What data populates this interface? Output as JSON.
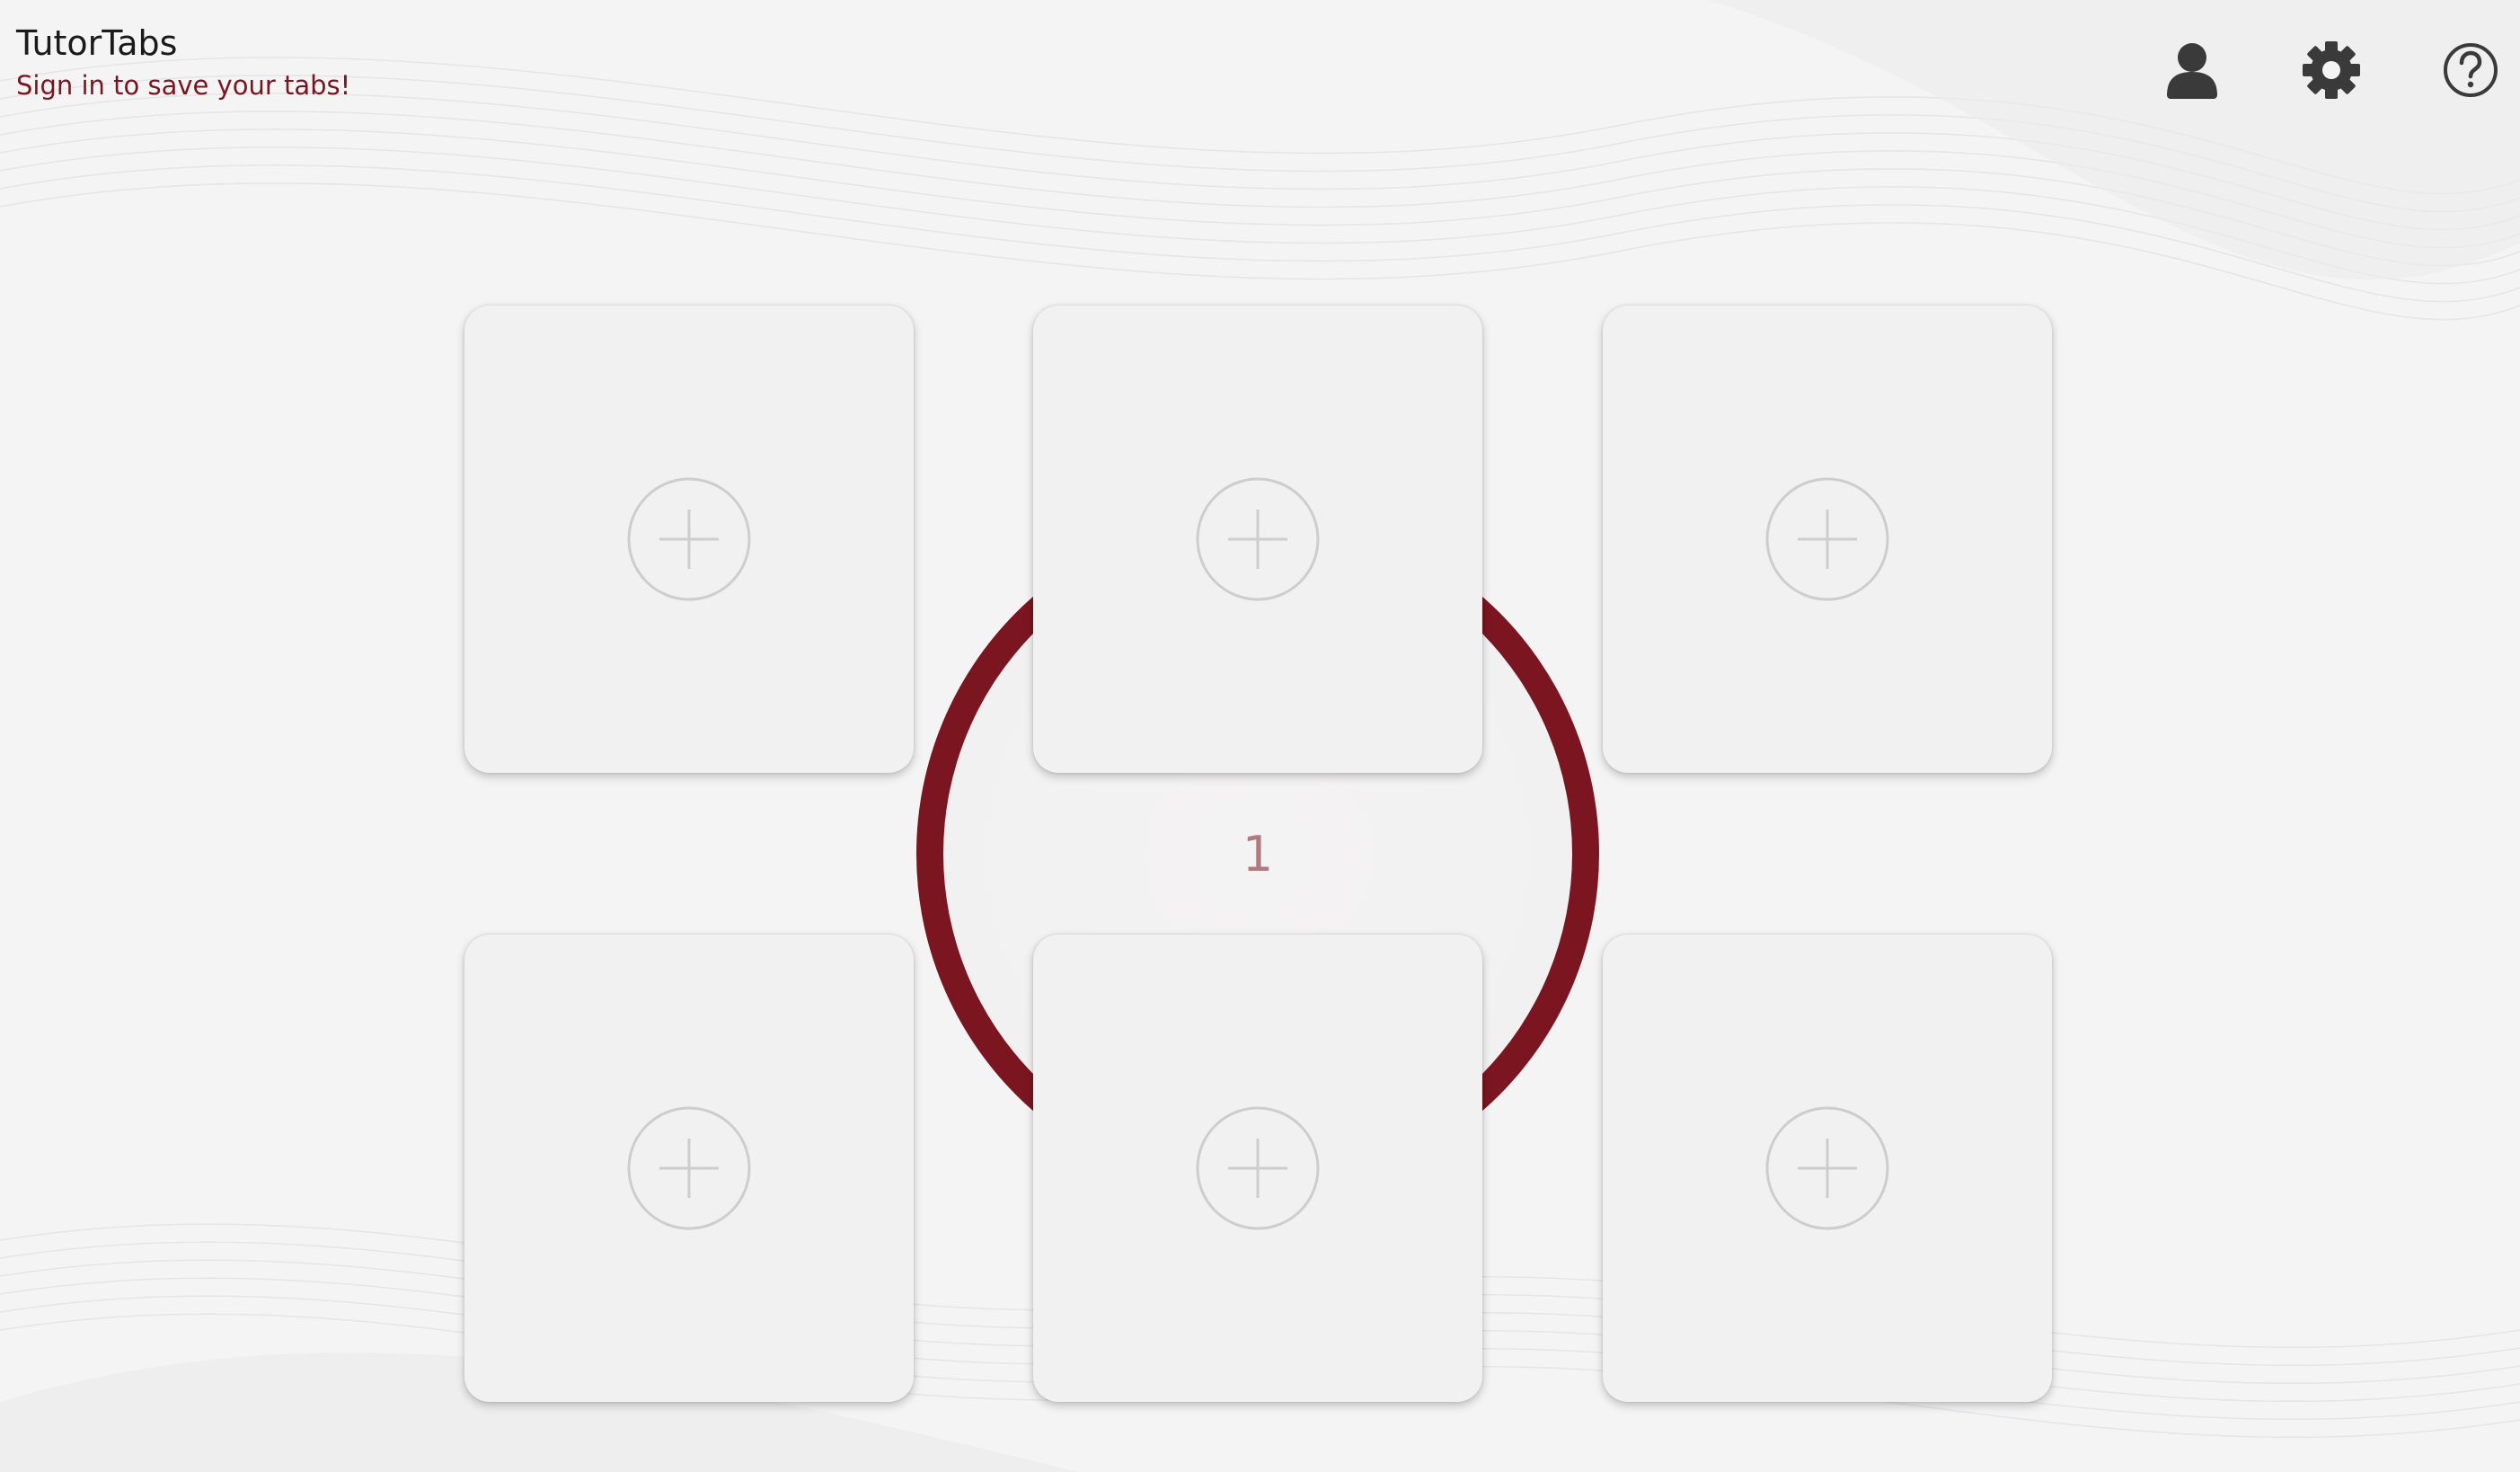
{
  "app": {
    "title": "TutorTabs",
    "signin_text": "Sign in to save your tabs!"
  },
  "top_icons": [
    {
      "name": "user-icon"
    },
    {
      "name": "gear-icon"
    },
    {
      "name": "help-icon"
    }
  ],
  "center": {
    "page_number": "1"
  },
  "tiles": [
    {
      "icon": "plus-circle-icon"
    },
    {
      "icon": "plus-circle-icon"
    },
    {
      "icon": "plus-circle-icon"
    },
    {
      "icon": "plus-circle-icon"
    },
    {
      "icon": "plus-circle-icon"
    },
    {
      "icon": "plus-circle-icon"
    }
  ],
  "colors": {
    "accent": "#7b1620",
    "background": "#f4f4f5",
    "tile": "#f1f1f1",
    "icon": "#3a3a3a",
    "plus": "#c8c8c8"
  }
}
